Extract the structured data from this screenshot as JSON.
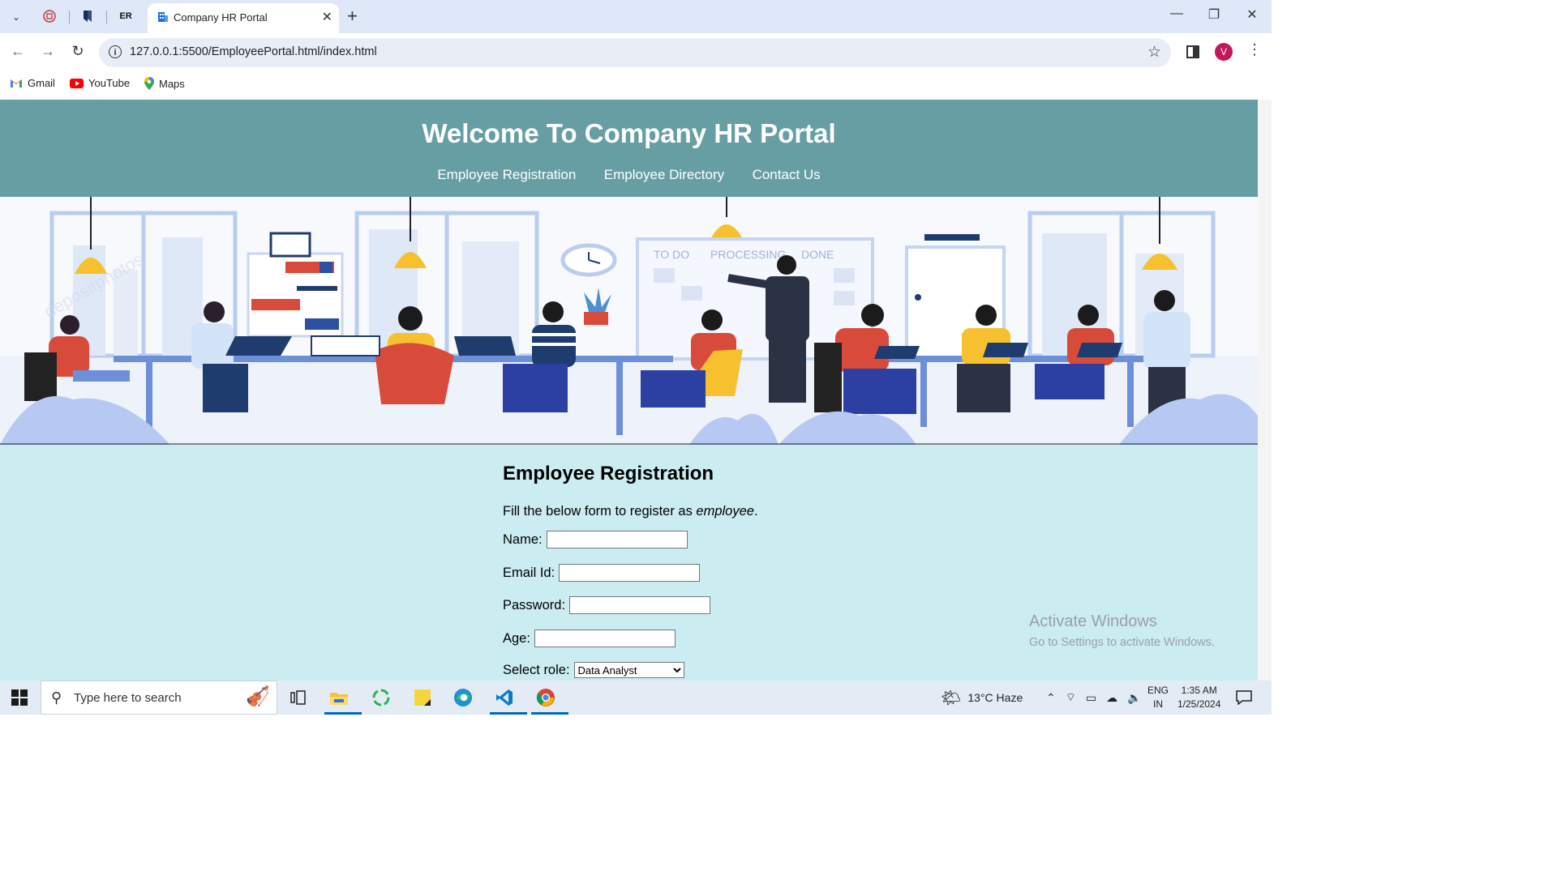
{
  "browser": {
    "pinned_tabs": [
      {
        "name": "pinned-tab-1",
        "glyph": "⧉"
      },
      {
        "name": "pinned-tab-2",
        "glyph": "◆"
      },
      {
        "name": "pinned-tab-3",
        "glyph": "ER"
      }
    ],
    "active_tab_title": "Company HR Portal",
    "url": "127.0.0.1:5500/EmployeePortal.html/index.html",
    "profile_initial": "V",
    "bookmarks": [
      {
        "label": "Gmail",
        "color": "#ea4335"
      },
      {
        "label": "YouTube",
        "color": "#ff0000"
      },
      {
        "label": "Maps",
        "color": "#34a853"
      }
    ]
  },
  "page": {
    "header_title": "Welcome To Company HR Portal",
    "nav": [
      "Employee Registration",
      "Employee Directory",
      "Contact Us"
    ],
    "banner": {
      "board_labels": [
        "TO DO",
        "PROCESSING",
        "DONE"
      ],
      "watermark": "depositphotos"
    },
    "form": {
      "heading": "Employee Registration",
      "intro_prefix": "Fill the below form to register as ",
      "intro_emphasis": "employee",
      "intro_suffix": ".",
      "name_label": "Name:",
      "email_label": "Email Id:",
      "password_label": "Password:",
      "age_label": "Age:",
      "role_label": "Select role:",
      "role_selected": "Data Analyst"
    },
    "colors": {
      "header_bg": "#679ea4",
      "form_bg": "#cbecf1"
    }
  },
  "os": {
    "watermark_line1": "Activate Windows",
    "watermark_line2": "Go to Settings to activate Windows.",
    "search_placeholder": "Type here to search",
    "weather": "13°C  Haze",
    "lang1": "ENG",
    "lang2": "IN",
    "time": "1:35 AM",
    "date": "1/25/2024"
  }
}
